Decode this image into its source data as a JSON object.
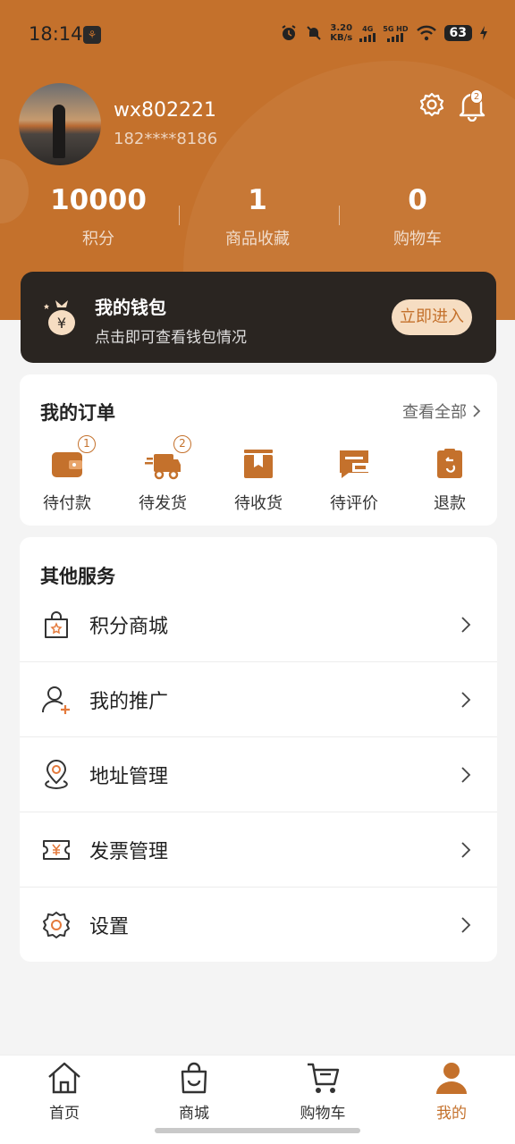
{
  "colors": {
    "accent": "#c4712c",
    "dark_card": "#2a2521",
    "background": "#f4f4f4"
  },
  "status_bar": {
    "time": "18:14",
    "net_speed_value": "3.20",
    "net_speed_unit": "KB/s",
    "network_1": "4G",
    "network_2": "5G HD",
    "battery": "63"
  },
  "profile": {
    "username": "wx802221",
    "phone": "182****8186",
    "notification_count": "2"
  },
  "stats": [
    {
      "value": "10000",
      "label": "积分"
    },
    {
      "value": "1",
      "label": "商品收藏"
    },
    {
      "value": "0",
      "label": "购物车"
    }
  ],
  "wallet": {
    "title": "我的钱包",
    "subtitle": "点击即可查看钱包情况",
    "button": "立即进入"
  },
  "orders": {
    "title": "我的订单",
    "view_all": "查看全部",
    "items": [
      {
        "label": "待付款",
        "badge": "1",
        "icon": "wallet-icon"
      },
      {
        "label": "待发货",
        "badge": "2",
        "icon": "truck-icon"
      },
      {
        "label": "待收货",
        "badge": "",
        "icon": "package-icon"
      },
      {
        "label": "待评价",
        "badge": "",
        "icon": "comment-icon"
      },
      {
        "label": "退款",
        "badge": "",
        "icon": "refund-icon"
      }
    ]
  },
  "services": {
    "title": "其他服务",
    "items": [
      {
        "label": "积分商城",
        "icon": "shopping-bag-icon"
      },
      {
        "label": "我的推广",
        "icon": "user-add-icon"
      },
      {
        "label": "地址管理",
        "icon": "location-pin-icon"
      },
      {
        "label": "发票管理",
        "icon": "invoice-icon"
      },
      {
        "label": "设置",
        "icon": "settings-icon"
      }
    ]
  },
  "tabbar": [
    {
      "label": "首页",
      "icon": "home-icon",
      "active": false
    },
    {
      "label": "商城",
      "icon": "shop-bag-icon",
      "active": false
    },
    {
      "label": "购物车",
      "icon": "cart-icon",
      "active": false
    },
    {
      "label": "我的",
      "icon": "profile-icon",
      "active": true
    }
  ]
}
